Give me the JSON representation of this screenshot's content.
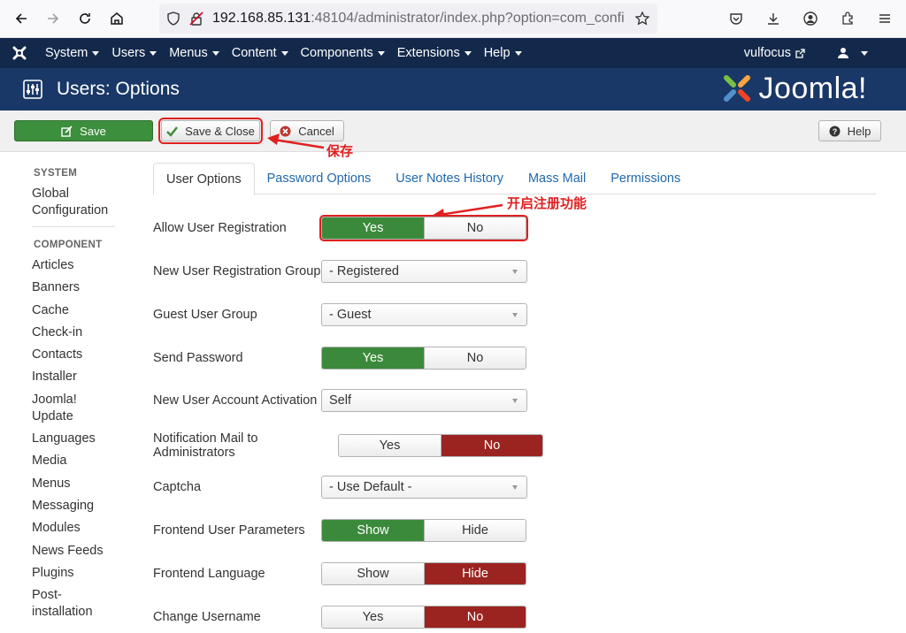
{
  "browser": {
    "url_host": "192.168.85.131",
    "url_rest": ":48104/administrator/index.php?option=com_confi"
  },
  "topnav": {
    "items": [
      "System",
      "Users",
      "Menus",
      "Content",
      "Components",
      "Extensions",
      "Help"
    ],
    "site_link": "vulfocus"
  },
  "header": {
    "title": "Users: Options",
    "logo_text": "Joomla!"
  },
  "toolbar": {
    "save": "Save",
    "save_close": "Save & Close",
    "cancel": "Cancel",
    "help": "Help"
  },
  "annotations": {
    "save_note": "保存",
    "enable_note": "开启注册功能"
  },
  "sidebar": {
    "system_head": "SYSTEM",
    "system_items": [
      "Global",
      "Configuration"
    ],
    "component_head": "COMPONENT",
    "items": [
      "Articles",
      "Banners",
      "Cache",
      "Check-in",
      "Contacts",
      "Installer",
      "Joomla!",
      "Update",
      "Languages",
      "Media",
      "Menus",
      "Messaging",
      "Modules",
      "News Feeds",
      "Plugins",
      "Post-",
      "installation"
    ]
  },
  "tabs": [
    "User Options",
    "Password Options",
    "User Notes History",
    "Mass Mail",
    "Permissions"
  ],
  "options": {
    "allow_reg": {
      "label": "Allow User Registration",
      "a": "Yes",
      "b": "No"
    },
    "new_group": {
      "label": "New User Registration Group",
      "value": "- Registered"
    },
    "guest_group": {
      "label": "Guest User Group",
      "value": "- Guest"
    },
    "send_pw": {
      "label": "Send Password",
      "a": "Yes",
      "b": "No"
    },
    "activation": {
      "label": "New User Account Activation",
      "value": "Self"
    },
    "notif": {
      "label": "Notification Mail to Administrators",
      "a": "Yes",
      "b": "No"
    },
    "captcha": {
      "label": "Captcha",
      "value": "- Use Default -"
    },
    "frontend_params": {
      "label": "Frontend User Parameters",
      "a": "Show",
      "b": "Hide"
    },
    "frontend_lang": {
      "label": "Frontend Language",
      "a": "Show",
      "b": "Hide"
    },
    "change_username": {
      "label": "Change Username",
      "a": "Yes",
      "b": "No"
    }
  },
  "colors": {
    "nav": "#13294b",
    "header": "#1a3867",
    "green": "#3b8a3b",
    "red": "#9b2420",
    "annotation": "#e02020"
  }
}
